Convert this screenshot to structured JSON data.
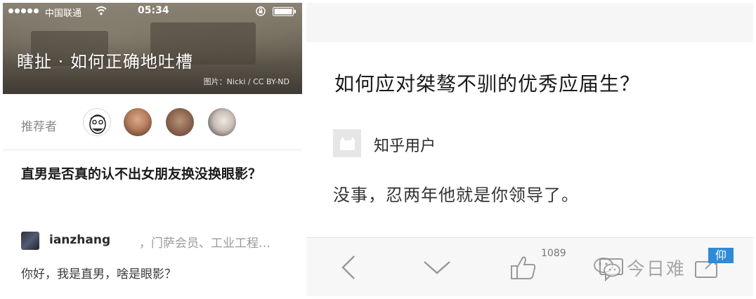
{
  "left": {
    "status_bar": {
      "carrier": "中国联通",
      "time": "05:34"
    },
    "hero": {
      "title": "瞎扯 · 如何正确地吐槽",
      "credit": "图片：Nicki / CC BY-ND"
    },
    "recommenders_label": "推荐者",
    "question": "直男是否真的认不出女朋友换没换眼影？",
    "author": {
      "name": "ianzhang",
      "title": "，门萨会员、工业工程…"
    },
    "answer_excerpt": "你好，我是直男，啥是眼影？"
  },
  "right": {
    "question": "如何应对桀骜不驯的优秀应届生？",
    "user_name": "知乎用户",
    "answer": "没事，忍两年他就是你领导了。",
    "toolbar": {
      "like_count": "1089"
    },
    "watermark": {
      "text": "今日难",
      "tag": "仰"
    }
  },
  "icons": [
    "signal-dots-icon",
    "wifi-icon",
    "lock-icon",
    "battery-icon",
    "back-chevron-icon",
    "down-chevron-icon",
    "thumbs-up-icon",
    "comment-icon",
    "share-icon",
    "wechat-icon"
  ],
  "colors": {
    "accent": "#2f8ad8",
    "muted_text": "#9a9a9a",
    "toolbar_bg": "#f7f7f7"
  }
}
